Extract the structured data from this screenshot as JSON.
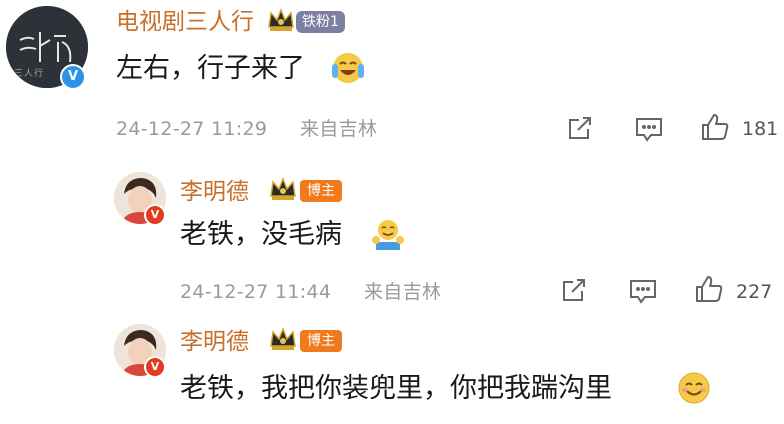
{
  "colors": {
    "username": "#c96f2a",
    "fan_badge": "#7d7fa0",
    "host_badge": "#f07a1e",
    "meta_text": "#9a9a9a"
  },
  "comments": [
    {
      "username": "电视剧三人行",
      "badge": "铁粉1",
      "avatar_text": "三人行",
      "text": "左右，行子来了",
      "emoji": "laughing-crying-emoji",
      "timestamp": "24-12-27 11:29",
      "location": "来自吉林",
      "likes": "181"
    },
    {
      "username": "李明德",
      "badge": "博主",
      "text": "老铁，没毛病",
      "emoji": "thumbs-up-emoji",
      "timestamp": "24-12-27 11:44",
      "location": "来自吉林",
      "likes": "227"
    },
    {
      "username": "李明德",
      "badge": "博主",
      "text": "老铁，我把你装兜里，你把我踹沟里",
      "emoji": "smile-emoji"
    }
  ]
}
